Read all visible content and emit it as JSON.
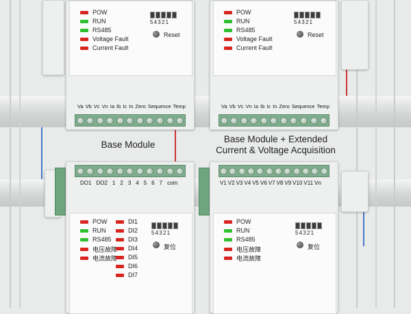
{
  "colors": {
    "led_red": "#d8241f",
    "led_green": "#2fbf2f",
    "terminal": "#7fae8e"
  },
  "top_left": {
    "indicators": [
      {
        "label": "POW",
        "color": "red"
      },
      {
        "label": "RUN",
        "color": "green"
      },
      {
        "label": "RS485",
        "color": "green"
      },
      {
        "label": "Voltage Fault",
        "color": "red"
      },
      {
        "label": "Current Fault",
        "color": "red"
      }
    ],
    "dip_numbers": "54321",
    "reset_label": "Reset",
    "terminal_labels": [
      "Va",
      "Vb",
      "Vc",
      "Vn",
      "Ia",
      "Ib",
      "Ic",
      "In",
      "Zero",
      "Sequence",
      "Temp"
    ]
  },
  "top_right": {
    "indicators": [
      {
        "label": "POW",
        "color": "red"
      },
      {
        "label": "RUN",
        "color": "green"
      },
      {
        "label": "RS485",
        "color": "green"
      },
      {
        "label": "Voltage Fault",
        "color": "red"
      },
      {
        "label": "Current Fault",
        "color": "red"
      }
    ],
    "dip_numbers": "54321",
    "reset_label": "Reset",
    "terminal_labels": [
      "Va",
      "Vb",
      "Vc",
      "Vn",
      "Ia",
      "Ib",
      "Ic",
      "In",
      "Zero",
      "Sequence",
      "Temp"
    ]
  },
  "titles": {
    "left": "Base Module",
    "right_line1": "Base Module + Extended",
    "right_line2": "Current & Voltage Acquisition"
  },
  "bottom_left": {
    "terminal_labels": [
      "DO1",
      "DO2",
      "1",
      "2",
      "3",
      "4",
      "5",
      "6",
      "7",
      "com"
    ],
    "indicators": [
      {
        "label": "POW",
        "color": "red"
      },
      {
        "label": "RUN",
        "color": "green"
      },
      {
        "label": "RS485",
        "color": "green"
      },
      {
        "label": "电压故障",
        "color": "red"
      },
      {
        "label": "电流故障",
        "color": "red"
      }
    ],
    "di": [
      "DI1",
      "DI2",
      "DI3",
      "DI4",
      "DI5",
      "DI6",
      "DI7"
    ],
    "dip_numbers": "54321",
    "reset_label": "复位"
  },
  "bottom_right": {
    "terminal_labels": [
      "V1",
      "V2",
      "V3",
      "V4",
      "V5",
      "V6",
      "V7",
      "V8",
      "V9",
      "V10",
      "V11",
      "Vn"
    ],
    "indicators": [
      {
        "label": "POW",
        "color": "red"
      },
      {
        "label": "RUN",
        "color": "green"
      },
      {
        "label": "RS485",
        "color": "green"
      },
      {
        "label": "电压故障",
        "color": "red"
      },
      {
        "label": "电流故障",
        "color": "red"
      }
    ],
    "dip_numbers": "54321",
    "reset_label": "复位"
  }
}
